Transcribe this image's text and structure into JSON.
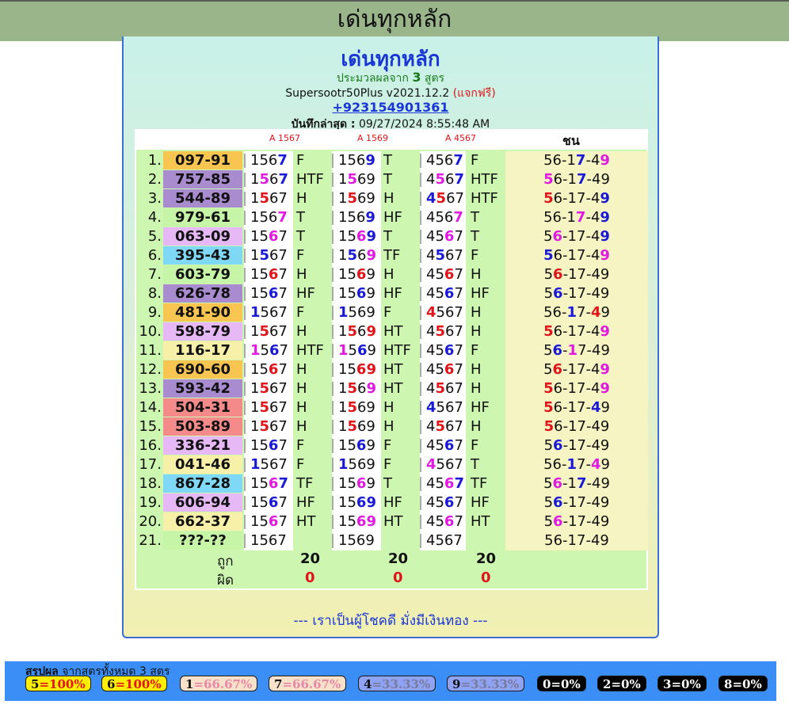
{
  "topbar": {
    "title": "เด่นทุกหลัก"
  },
  "card": {
    "title": "เด่นทุกหลัก",
    "subtitle_pre": "ประมวลผลจาก",
    "subtitle_num": "3",
    "subtitle_post": "สูตร",
    "version": "Supersootr50Plus v2021.12.2",
    "free": "(แจกฟรี)",
    "phone": "+923154901361",
    "saved_label": "บันทึกล่าสุด :",
    "saved_value": "09/27/2024 8:55:48 AM",
    "slogan": "--- เราเป็นผู้โชคดี มั่งมีเงินทอง ---"
  },
  "table": {
    "headers": {
      "a1": "A 1567",
      "a2": "A 1569",
      "a3": "A 4567",
      "chon": "ชน"
    },
    "rows": [
      {
        "n": "1.",
        "main": "097-91",
        "bg": "#f8c550",
        "c1": "156<b>7</b>",
        "t1": "F",
        "c2": "156<b>9</b>",
        "t2": "T",
        "c3": "456<b>7</b>",
        "t3": "F",
        "chon": "56-1<b>7</b>-4<m>9</m>"
      },
      {
        "n": "2.",
        "main": "757-85",
        "bg": "#a98bd0",
        "c1": "1<m>5</m>6<b>7</b>",
        "t1": "HTF",
        "c2": "1<m>5</m>69",
        "t2": "T",
        "c3": "4<m>5</m>6<b>7</b>",
        "t3": "HTF",
        "chon": "<m>5</m>6-1<b>7</b>-49"
      },
      {
        "n": "3.",
        "main": "544-89",
        "bg": "#a98bd0",
        "c1": "1<r>5</r>67",
        "t1": "H",
        "c2": "1<r>5</r>69",
        "t2": "H",
        "c3": "<b>4</b><r>5</r>67",
        "t3": "HTF",
        "chon": "<r>5</r>6-17-4<b>9</b>"
      },
      {
        "n": "4.",
        "main": "979-61",
        "bg": "#c6f5a8",
        "c1": "156<m>7</m>",
        "t1": "T",
        "c2": "156<b>9</b>",
        "t2": "HF",
        "c3": "456<m>7</m>",
        "t3": "T",
        "chon": "56-1<m>7</m>-4<b>9</b>"
      },
      {
        "n": "5.",
        "main": "063-09",
        "bg": "#e6b8f5",
        "c1": "15<m>6</m>7",
        "t1": "T",
        "c2": "15<m>6</m><b>9</b>",
        "t2": "T",
        "c3": "45<m>6</m>7",
        "t3": "T",
        "chon": "5<m>6</m>-17-4<b>9</b>"
      },
      {
        "n": "6.",
        "main": "395-43",
        "bg": "#7fd8f5",
        "c1": "1<b>5</b>67",
        "t1": "F",
        "c2": "1<b>5</b>6<m>9</m>",
        "t2": "TF",
        "c3": "4<b>5</b>67",
        "t3": "F",
        "chon": "<b>5</b>6-17-4<m>9</m>"
      },
      {
        "n": "7.",
        "main": "603-79",
        "bg": "#c6f5a8",
        "c1": "15<r>6</r>7",
        "t1": "H",
        "c2": "15<r>6</r>9",
        "t2": "H",
        "c3": "45<r>6</r>7",
        "t3": "H",
        "chon": "5<r>6</r>-17-49"
      },
      {
        "n": "8.",
        "main": "626-78",
        "bg": "#a98bd0",
        "c1": "15<b>6</b>7",
        "t1": "HF",
        "c2": "15<b>6</b>9",
        "t2": "HF",
        "c3": "45<b>6</b>7",
        "t3": "HF",
        "chon": "5<b>6</b>-17-49"
      },
      {
        "n": "9.",
        "main": "481-90",
        "bg": "#f8c550",
        "c1": "<b>1</b>567",
        "t1": "F",
        "c2": "<b>1</b>569",
        "t2": "F",
        "c3": "<r>4</r>567",
        "t3": "H",
        "chon": "56-<b>1</b>7-<r>4</r>9"
      },
      {
        "n": "10.",
        "main": "598-79",
        "bg": "#e6b8f5",
        "c1": "1<r>5</r>67",
        "t1": "H",
        "c2": "1<r>5</r>6<r>9</r>",
        "t2": "HT",
        "c3": "4<r>5</r>67",
        "t3": "H",
        "chon": "<r>5</r>6-17-4<m>9</m>"
      },
      {
        "n": "11.",
        "main": "116-17",
        "bg": "#f7f0a8",
        "c1": "<m>1</m>5<b>6</b>7",
        "t1": "HTF",
        "c2": "<m>1</m>5<b>6</b>9",
        "t2": "HTF",
        "c3": "45<b>6</b>7",
        "t3": "F",
        "chon": "5<b>6</b>-<m>1</m>7-49"
      },
      {
        "n": "12.",
        "main": "690-60",
        "bg": "#f8c550",
        "c1": "15<r>6</r>7",
        "t1": "H",
        "c2": "15<r>6</r><r>9</r>",
        "t2": "HT",
        "c3": "45<r>6</r>7",
        "t3": "H",
        "chon": "5<r>6</r>-17-4<m>9</m>"
      },
      {
        "n": "13.",
        "main": "593-42",
        "bg": "#a98bd0",
        "c1": "1<r>5</r>67",
        "t1": "H",
        "c2": "1<r>5</r>6<m>9</m>",
        "t2": "HT",
        "c3": "4<r>5</r>67",
        "t3": "H",
        "chon": "<r>5</r>6-17-4<m>9</m>"
      },
      {
        "n": "14.",
        "main": "504-31",
        "bg": "#f58a8a",
        "c1": "1<r>5</r>67",
        "t1": "H",
        "c2": "1<r>5</r>69",
        "t2": "H",
        "c3": "<b>4</b>567",
        "t3": "HF",
        "chon": "<r>5</r>6-17-<b>4</b>9"
      },
      {
        "n": "15.",
        "main": "503-89",
        "bg": "#f58a8a",
        "c1": "1<r>5</r>67",
        "t1": "H",
        "c2": "1<r>5</r>69",
        "t2": "H",
        "c3": "4<r>5</r>67",
        "t3": "H",
        "chon": "<r>5</r>6-17-49"
      },
      {
        "n": "16.",
        "main": "336-21",
        "bg": "#e6b8f5",
        "c1": "15<b>6</b>7",
        "t1": "F",
        "c2": "15<b>6</b>9",
        "t2": "F",
        "c3": "45<b>6</b>7",
        "t3": "F",
        "chon": "5<b>6</b>-17-49"
      },
      {
        "n": "17.",
        "main": "041-46",
        "bg": "#f7f0a8",
        "c1": "<b>1</b>567",
        "t1": "F",
        "c2": "<b>1</b>569",
        "t2": "F",
        "c3": "<m>4</m>567",
        "t3": "T",
        "chon": "56-<b>1</b>7-<m>4</m>9"
      },
      {
        "n": "18.",
        "main": "867-28",
        "bg": "#7fd8f5",
        "c1": "15<m>6</m><b>7</b>",
        "t1": "TF",
        "c2": "15<m>6</m>9",
        "t2": "T",
        "c3": "45<m>6</m><b>7</b>",
        "t3": "TF",
        "chon": "5<m>6</m>-1<b>7</b>-49"
      },
      {
        "n": "19.",
        "main": "606-94",
        "bg": "#e6b8f5",
        "c1": "15<b>6</b>7",
        "t1": "HF",
        "c2": "15<b>6</b><b>9</b>",
        "t2": "HF",
        "c3": "45<b>6</b>7",
        "t3": "HF",
        "chon": "5<b>6</b>-17-49"
      },
      {
        "n": "20.",
        "main": "662-37",
        "bg": "#f7f0a8",
        "c1": "15<m>6</m>7",
        "t1": "HT",
        "c2": "15<m>6</m><m>9</m>",
        "t2": "HT",
        "c3": "45<m>6</m>7",
        "t3": "HT",
        "chon": "5<m>6</m>-17-49"
      },
      {
        "n": "21.",
        "main": "???-??",
        "bg": "#c6f5a8",
        "c1": "1567",
        "t1": "",
        "c2": "1569",
        "t2": "",
        "c3": "4567",
        "t3": "",
        "chon": "56-17-49"
      }
    ],
    "correct_label": "ถูก",
    "wrong_label": "ผิด",
    "correct": [
      "20",
      "20",
      "20"
    ],
    "wrong": [
      "0",
      "0",
      "0"
    ]
  },
  "summary": {
    "title_bold": "สรุปผล",
    "title_rest": "จากสูตรทั้งหมด 3 สูตร",
    "pills": [
      {
        "digit": "5",
        "pct": "=100%",
        "bg": "#ffee00",
        "fg": "#111",
        "pc": "#e0141a"
      },
      {
        "digit": "6",
        "pct": "=100%",
        "bg": "#ffee00",
        "fg": "#111",
        "pc": "#e0141a"
      },
      {
        "digit": "1",
        "pct": "=66.67%",
        "bg": "#f7e1c8",
        "fg": "#111",
        "pc": "#e888a8"
      },
      {
        "digit": "7",
        "pct": "=66.67%",
        "bg": "#f7e1c8",
        "fg": "#111",
        "pc": "#e888a8"
      },
      {
        "digit": "4",
        "pct": "=33.33%",
        "bg": "#8fa3f5",
        "fg": "#111",
        "pc": "#7a7a9a"
      },
      {
        "digit": "9",
        "pct": "=33.33%",
        "bg": "#8fa3f5",
        "fg": "#111",
        "pc": "#7a7a9a"
      },
      {
        "digit": "0",
        "pct": "=0%",
        "bg": "#000000",
        "fg": "#ffffff",
        "pc": "#ffffff"
      },
      {
        "digit": "2",
        "pct": "=0%",
        "bg": "#000000",
        "fg": "#ffffff",
        "pc": "#ffffff"
      },
      {
        "digit": "3",
        "pct": "=0%",
        "bg": "#000000",
        "fg": "#ffffff",
        "pc": "#ffffff"
      },
      {
        "digit": "8",
        "pct": "=0%",
        "bg": "#000000",
        "fg": "#ffffff",
        "pc": "#ffffff"
      }
    ]
  }
}
